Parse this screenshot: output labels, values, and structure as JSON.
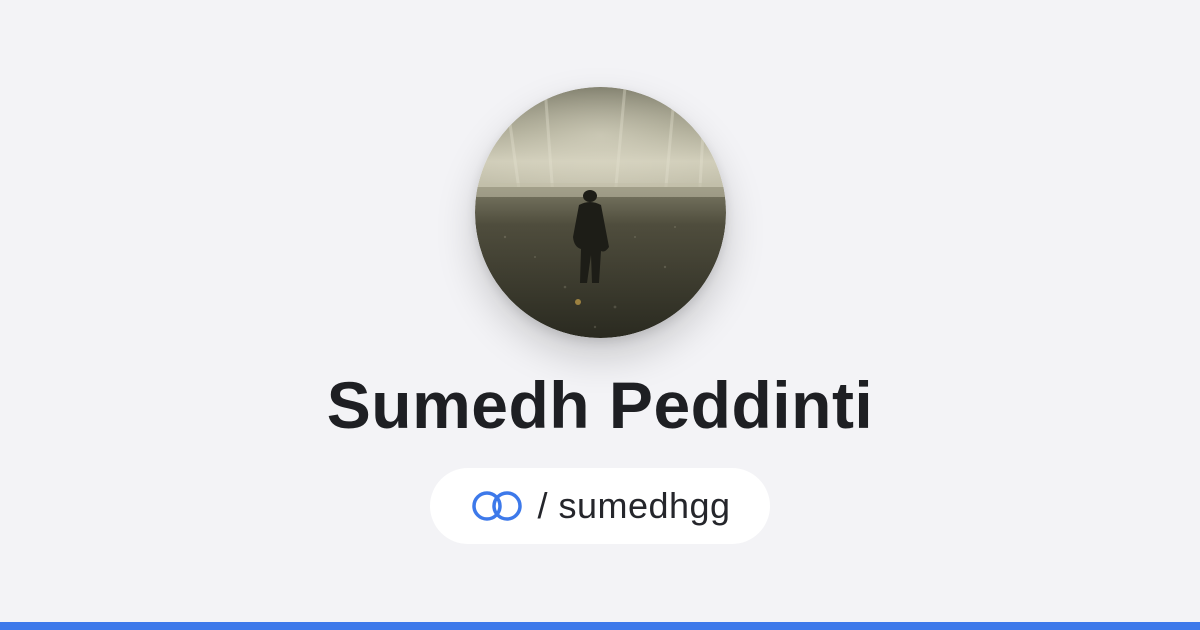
{
  "profile": {
    "name": "Sumedh Peddinti",
    "handle": "/ sumedhgg",
    "avatar_icon": "profile-photo"
  },
  "colors": {
    "background": "#f3f3f6",
    "accent": "#3d79ea",
    "text": "#1e1f23",
    "pill_background": "#ffffff"
  },
  "icons": {
    "handle_icon": "linked-rings-icon"
  }
}
